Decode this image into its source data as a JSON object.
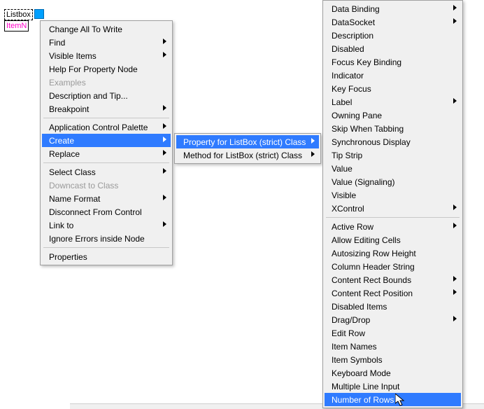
{
  "node": {
    "label1": "Listbox",
    "label2": "ItemN"
  },
  "menu1": {
    "items": [
      {
        "label": "Change All To Write",
        "arrow": false,
        "disabled": false
      },
      {
        "label": "Find",
        "arrow": true,
        "disabled": false
      },
      {
        "label": "Visible Items",
        "arrow": true,
        "disabled": false
      },
      {
        "label": "Help For Property Node",
        "arrow": false,
        "disabled": false
      },
      {
        "label": "Examples",
        "arrow": false,
        "disabled": true
      },
      {
        "label": "Description and Tip...",
        "arrow": false,
        "disabled": false
      },
      {
        "label": "Breakpoint",
        "arrow": true,
        "disabled": false
      },
      {
        "sep": true
      },
      {
        "label": "Application Control Palette",
        "arrow": true,
        "disabled": false
      },
      {
        "label": "Create",
        "arrow": true,
        "disabled": false,
        "highlight": true
      },
      {
        "label": "Replace",
        "arrow": true,
        "disabled": false
      },
      {
        "sep": true
      },
      {
        "label": "Select Class",
        "arrow": true,
        "disabled": false
      },
      {
        "label": "Downcast to Class",
        "arrow": false,
        "disabled": true
      },
      {
        "label": "Name Format",
        "arrow": true,
        "disabled": false
      },
      {
        "label": "Disconnect From Control",
        "arrow": false,
        "disabled": false
      },
      {
        "label": "Link to",
        "arrow": true,
        "disabled": false
      },
      {
        "label": "Ignore Errors inside Node",
        "arrow": false,
        "disabled": false
      },
      {
        "sep": true
      },
      {
        "label": "Properties",
        "arrow": false,
        "disabled": false
      }
    ]
  },
  "menu2": {
    "items": [
      {
        "label": "Property for ListBox (strict) Class",
        "arrow": true,
        "highlight": true
      },
      {
        "label": "Method for ListBox (strict) Class",
        "arrow": true
      }
    ]
  },
  "menu3": {
    "items": [
      {
        "label": "Data Binding",
        "arrow": true
      },
      {
        "label": "DataSocket",
        "arrow": true
      },
      {
        "label": "Description",
        "arrow": false
      },
      {
        "label": "Disabled",
        "arrow": false
      },
      {
        "label": "Focus Key Binding",
        "arrow": false
      },
      {
        "label": "Indicator",
        "arrow": false
      },
      {
        "label": "Key Focus",
        "arrow": false
      },
      {
        "label": "Label",
        "arrow": true
      },
      {
        "label": "Owning Pane",
        "arrow": false
      },
      {
        "label": "Skip When Tabbing",
        "arrow": false
      },
      {
        "label": "Synchronous Display",
        "arrow": false
      },
      {
        "label": "Tip Strip",
        "arrow": false
      },
      {
        "label": "Value",
        "arrow": false
      },
      {
        "label": "Value (Signaling)",
        "arrow": false
      },
      {
        "label": "Visible",
        "arrow": false
      },
      {
        "label": "XControl",
        "arrow": true
      },
      {
        "sep": true
      },
      {
        "label": "Active Row",
        "arrow": true
      },
      {
        "label": "Allow Editing Cells",
        "arrow": false
      },
      {
        "label": "Autosizing Row Height",
        "arrow": false
      },
      {
        "label": "Column Header String",
        "arrow": false
      },
      {
        "label": "Content Rect Bounds",
        "arrow": true
      },
      {
        "label": "Content Rect Position",
        "arrow": true
      },
      {
        "label": "Disabled Items",
        "arrow": false
      },
      {
        "label": "Drag/Drop",
        "arrow": true
      },
      {
        "label": "Edit Row",
        "arrow": false
      },
      {
        "label": "Item Names",
        "arrow": false
      },
      {
        "label": "Item Symbols",
        "arrow": false
      },
      {
        "label": "Keyboard Mode",
        "arrow": false
      },
      {
        "label": "Multiple Line Input",
        "arrow": false
      },
      {
        "label": "Number of Rows",
        "arrow": false,
        "highlight": true
      }
    ]
  }
}
